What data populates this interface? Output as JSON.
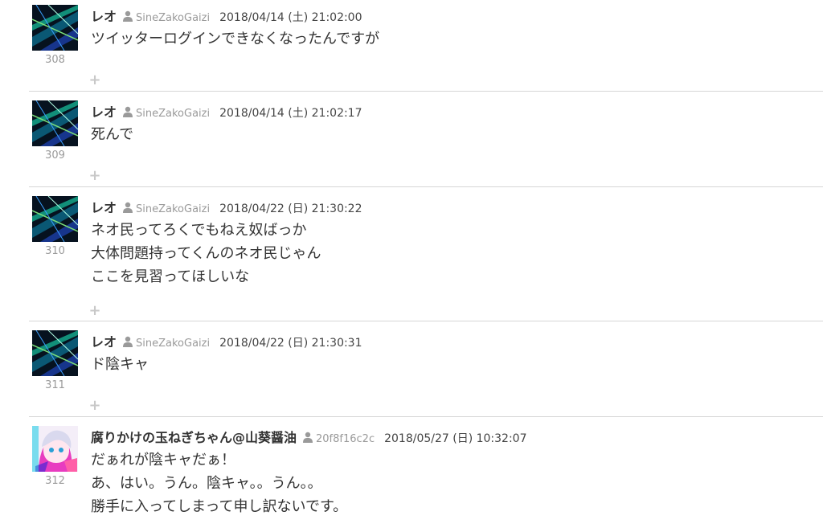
{
  "posts": [
    {
      "number": "308",
      "name": "レオ",
      "user_id": "SineZakoGaizi",
      "date": "2018/04/14 (土) 21:02:00",
      "avatar": "neon-city-avatar",
      "lines": [
        "ツイッターログインできなくなったんですが"
      ]
    },
    {
      "number": "309",
      "name": "レオ",
      "user_id": "SineZakoGaizi",
      "date": "2018/04/14 (土) 21:02:17",
      "avatar": "neon-city-avatar",
      "lines": [
        "死んで"
      ]
    },
    {
      "number": "310",
      "name": "レオ",
      "user_id": "SineZakoGaizi",
      "date": "2018/04/22 (日) 21:30:22",
      "avatar": "neon-city-avatar",
      "lines": [
        "ネオ民ってろくでもねえ奴ばっか",
        "大体問題持ってくんのネオ民じゃん",
        "ここを見習ってほしいな"
      ]
    },
    {
      "number": "311",
      "name": "レオ",
      "user_id": "SineZakoGaizi",
      "date": "2018/04/22 (日) 21:30:31",
      "avatar": "neon-city-avatar",
      "lines": [
        "ド陰キャ"
      ]
    },
    {
      "number": "312",
      "name": "腐りかけの玉ねぎちゃん@山葵醤油",
      "user_id": "20f8f16c2c",
      "date": "2018/05/27 (日) 10:32:07",
      "avatar": "anime-girl-avatar",
      "lines": [
        "だぁれが陰キャだぁ！",
        "あ、はい。うん。陰キャ。。うん。。",
        "勝手に入ってしまって申し訳ないです。"
      ]
    }
  ],
  "icons": {
    "user": "user-icon",
    "reply": "plus-icon"
  },
  "colors": {
    "meta_gray": "#9a9a9a",
    "divider": "#d6d6d6",
    "plus": "#c8c8c8"
  }
}
